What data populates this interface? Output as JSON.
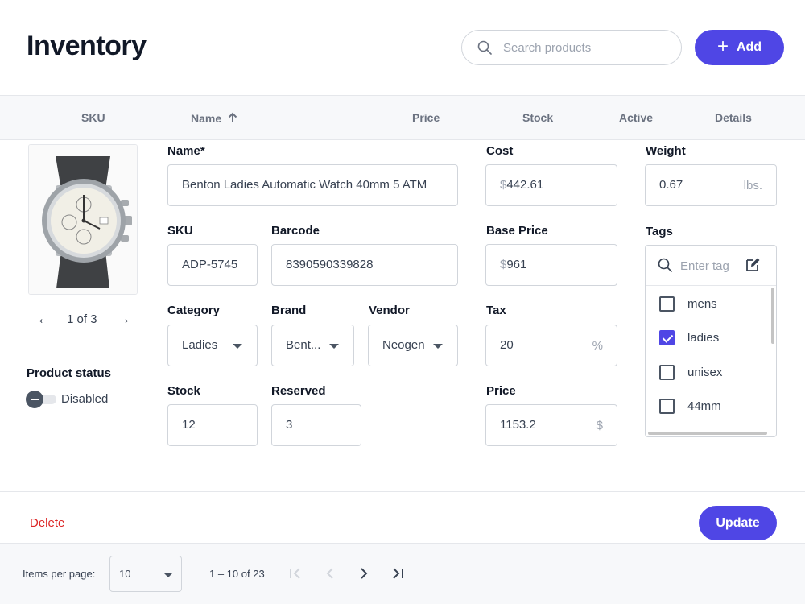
{
  "header": {
    "title": "Inventory",
    "search_placeholder": "Search products",
    "add_label": "Add",
    "accent_color": "#4f46e5"
  },
  "columns": {
    "sku": "SKU",
    "name": "Name",
    "price": "Price",
    "stock": "Stock",
    "active": "Active",
    "details": "Details",
    "sort_icon": "arrow-up-icon"
  },
  "gallery": {
    "counter": "1 of 3",
    "prev_icon": "arrow-left-icon",
    "next_icon": "arrow-right-icon"
  },
  "status": {
    "label": "Product status",
    "toggle_text": "Disabled",
    "enabled": false
  },
  "form": {
    "name": {
      "label": "Name*",
      "value": "Benton Ladies Automatic Watch 40mm 5 ATM"
    },
    "sku": {
      "label": "SKU",
      "value": "ADP-5745"
    },
    "barcode": {
      "label": "Barcode",
      "value": "8390590339828"
    },
    "category": {
      "label": "Category",
      "value": "Ladies"
    },
    "brand": {
      "label": "Brand",
      "value": "Bent..."
    },
    "vendor": {
      "label": "Vendor",
      "value": "Neogen"
    },
    "stock": {
      "label": "Stock",
      "value": "12"
    },
    "reserved": {
      "label": "Reserved",
      "value": "3"
    },
    "cost": {
      "label": "Cost",
      "currency": "$",
      "value": "442.61"
    },
    "base_price": {
      "label": "Base Price",
      "currency": "$",
      "value": "961"
    },
    "tax": {
      "label": "Tax",
      "value": "20",
      "suffix": "%"
    },
    "price": {
      "label": "Price",
      "value": "1153.2",
      "suffix": "$"
    },
    "weight": {
      "label": "Weight",
      "value": "0.67",
      "suffix": "lbs."
    }
  },
  "tags": {
    "label": "Tags",
    "placeholder": "Enter tag",
    "items": [
      {
        "label": "mens",
        "checked": false
      },
      {
        "label": "ladies",
        "checked": true
      },
      {
        "label": "unisex",
        "checked": false
      },
      {
        "label": "44mm",
        "checked": false
      }
    ]
  },
  "actions": {
    "delete_label": "Delete",
    "update_label": "Update",
    "delete_color": "#dc2626"
  },
  "pagination": {
    "items_per_page_label": "Items per page:",
    "items_per_page_value": "10",
    "range": "1 – 10 of 23"
  }
}
